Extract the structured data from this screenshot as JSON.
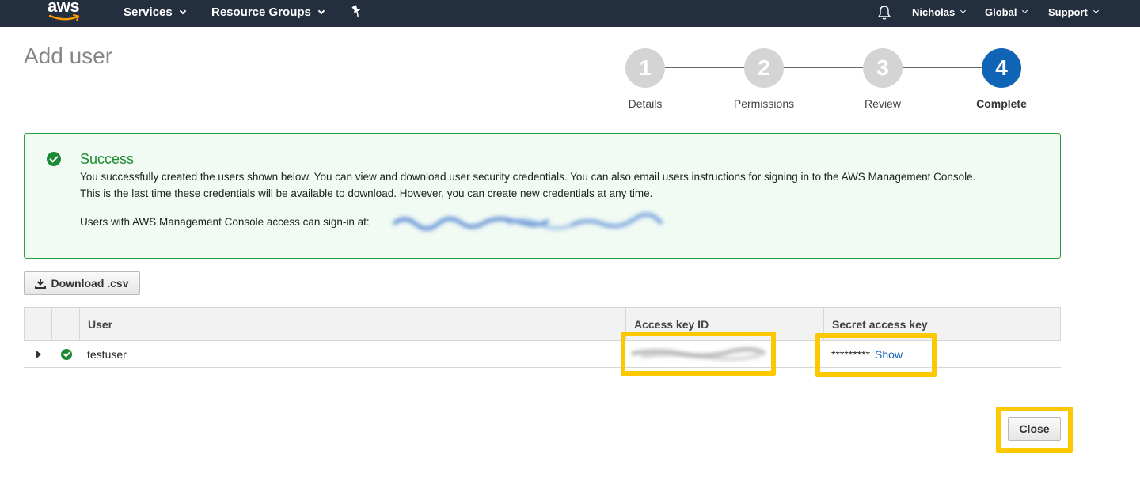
{
  "nav": {
    "logo_text": "aws",
    "services": "Services",
    "resource_groups": "Resource Groups",
    "user": "Nicholas",
    "region": "Global",
    "support": "Support"
  },
  "page": {
    "title": "Add user"
  },
  "steps": [
    {
      "number": "1",
      "label": "Details"
    },
    {
      "number": "2",
      "label": "Permissions"
    },
    {
      "number": "3",
      "label": "Review"
    },
    {
      "number": "4",
      "label": "Complete"
    }
  ],
  "success": {
    "title": "Success",
    "line1": "You successfully created the users shown below. You can view and download user security credentials. You can also email users instructions for signing in to the AWS Management Console.",
    "line2": "This is the last time these credentials will be available to download. However, you can create new credentials at any time.",
    "signin_label": "Users with AWS Management Console access can sign-in at:"
  },
  "download_label": "Download .csv",
  "table": {
    "headers": {
      "user": "User",
      "access_key": "Access key ID",
      "secret_key": "Secret access key"
    },
    "rows": [
      {
        "user": "testuser",
        "secret_mask": "*********",
        "show_label": "Show"
      }
    ]
  },
  "close_label": "Close",
  "colors": {
    "nav_bg": "#232f3e",
    "accent_blue": "#0f64b5",
    "success_green": "#1d8a34",
    "highlight_yellow": "#fcc800"
  }
}
